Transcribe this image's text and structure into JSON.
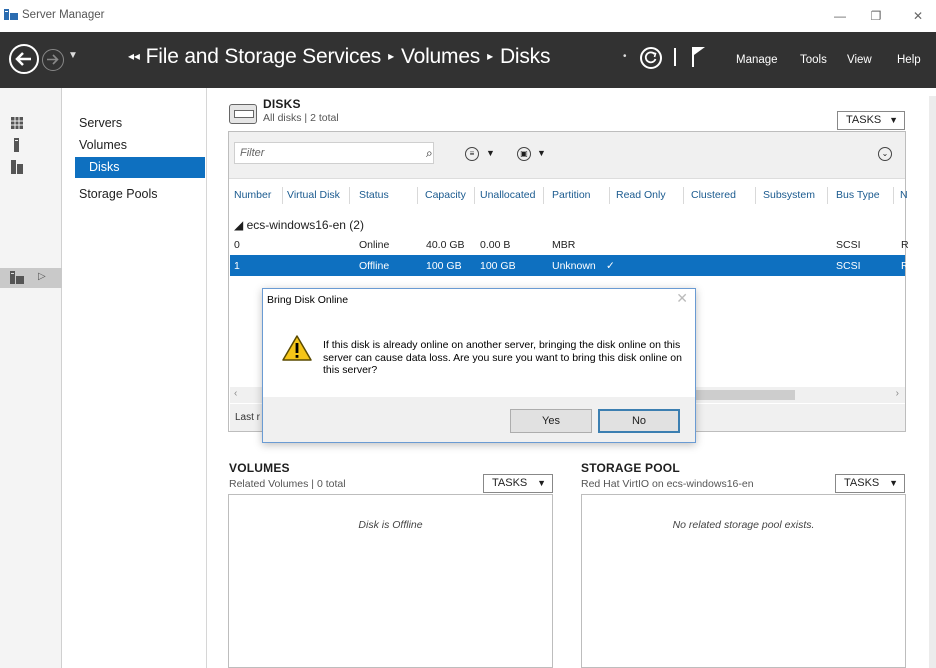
{
  "window": {
    "title": "Server Manager",
    "minimize_glyph": "—",
    "maximize_glyph": "❐",
    "close_glyph": "✕"
  },
  "header": {
    "breadcrumb_lead": "◂◂",
    "breadcrumb": [
      "File and Storage Services",
      "Volumes",
      "Disks"
    ],
    "breadcrumb_sep": "▸",
    "menu": [
      "Manage",
      "Tools",
      "View",
      "Help"
    ],
    "icons": [
      "back-icon",
      "forward-icon",
      "refresh-icon",
      "flag-icon"
    ]
  },
  "left_nav": {
    "icons": [
      "dashboard-icon",
      "local-server-icon",
      "all-servers-icon",
      "file-storage-icon"
    ],
    "active_arrow": "▷"
  },
  "sub_nav": {
    "items": [
      "Servers",
      "Volumes",
      "Disks",
      "Storage Pools"
    ],
    "active": "Disks"
  },
  "disks": {
    "title": "DISKS",
    "subtitle": "All disks | 2 total",
    "tasks_label": "TASKS",
    "filter_placeholder": "Filter",
    "columns": [
      "Number",
      "Virtual Disk",
      "Status",
      "Capacity",
      "Unallocated",
      "Partition",
      "Read Only",
      "Clustered",
      "Subsystem",
      "Bus Type",
      "N"
    ],
    "group": "◢  ecs-windows16-en (2)",
    "rows": [
      {
        "number": "0",
        "status": "Online",
        "capacity": "40.0 GB",
        "unallocated": "0.00 B",
        "partition": "MBR",
        "read_only": "",
        "bus_type": "SCSI",
        "n": "R"
      },
      {
        "number": "1",
        "status": "Offline",
        "capacity": "100 GB",
        "unallocated": "100 GB",
        "partition": "Unknown",
        "read_only": "✓",
        "bus_type": "SCSI",
        "n": "R"
      }
    ],
    "last_refresh_label": "Last r"
  },
  "dialog": {
    "title": "Bring Disk Online",
    "message": "If this disk is already online on another server, bringing the disk online on this server can cause data loss. Are you sure you want to bring this disk online on this server?",
    "yes": "Yes",
    "no": "No",
    "close": "✕"
  },
  "volumes": {
    "title": "VOLUMES",
    "subtitle": "Related Volumes | 0 total",
    "tasks_label": "TASKS",
    "empty": "Disk is Offline"
  },
  "storage_pool": {
    "title": "STORAGE POOL",
    "subtitle": "Red Hat VirtIO on ecs-windows16-en",
    "tasks_label": "TASKS",
    "empty": "No related storage pool exists."
  },
  "colors": {
    "header_bg": "#323232",
    "selection": "#0e70c0",
    "column_header": "#1a5a8f"
  }
}
